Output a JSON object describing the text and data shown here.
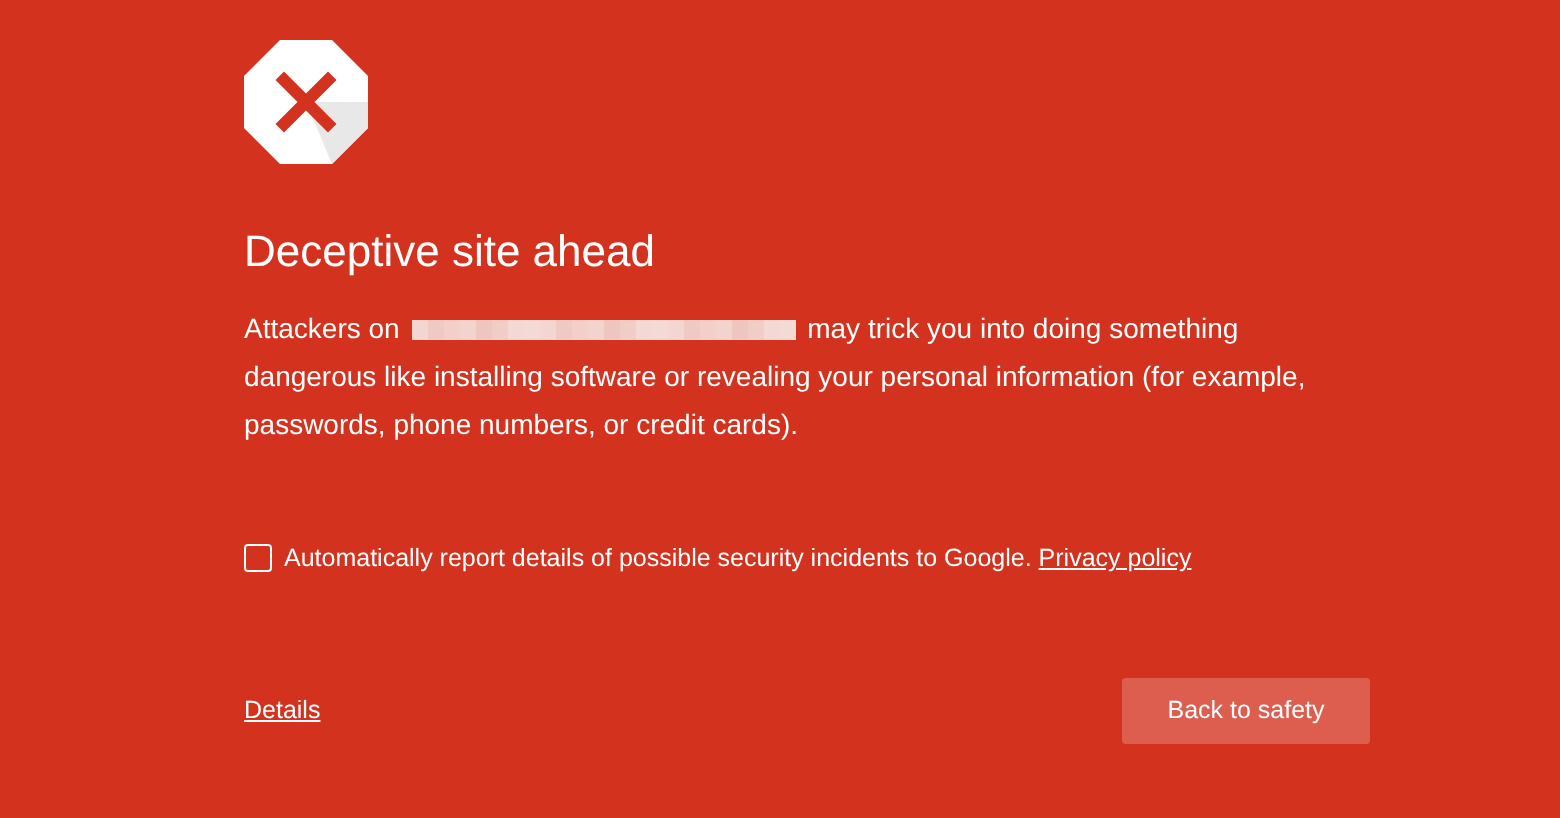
{
  "heading": "Deceptive site ahead",
  "message": {
    "before_url": "Attackers on",
    "after_url": "may trick you into doing something dangerous like installing software or revealing your personal information (for example, passwords, phone numbers, or credit cards)."
  },
  "report": {
    "label": "Automatically report details of possible security incidents to Google.",
    "link": "Privacy policy",
    "checked": false
  },
  "details_link": "Details",
  "back_button": "Back to safety"
}
